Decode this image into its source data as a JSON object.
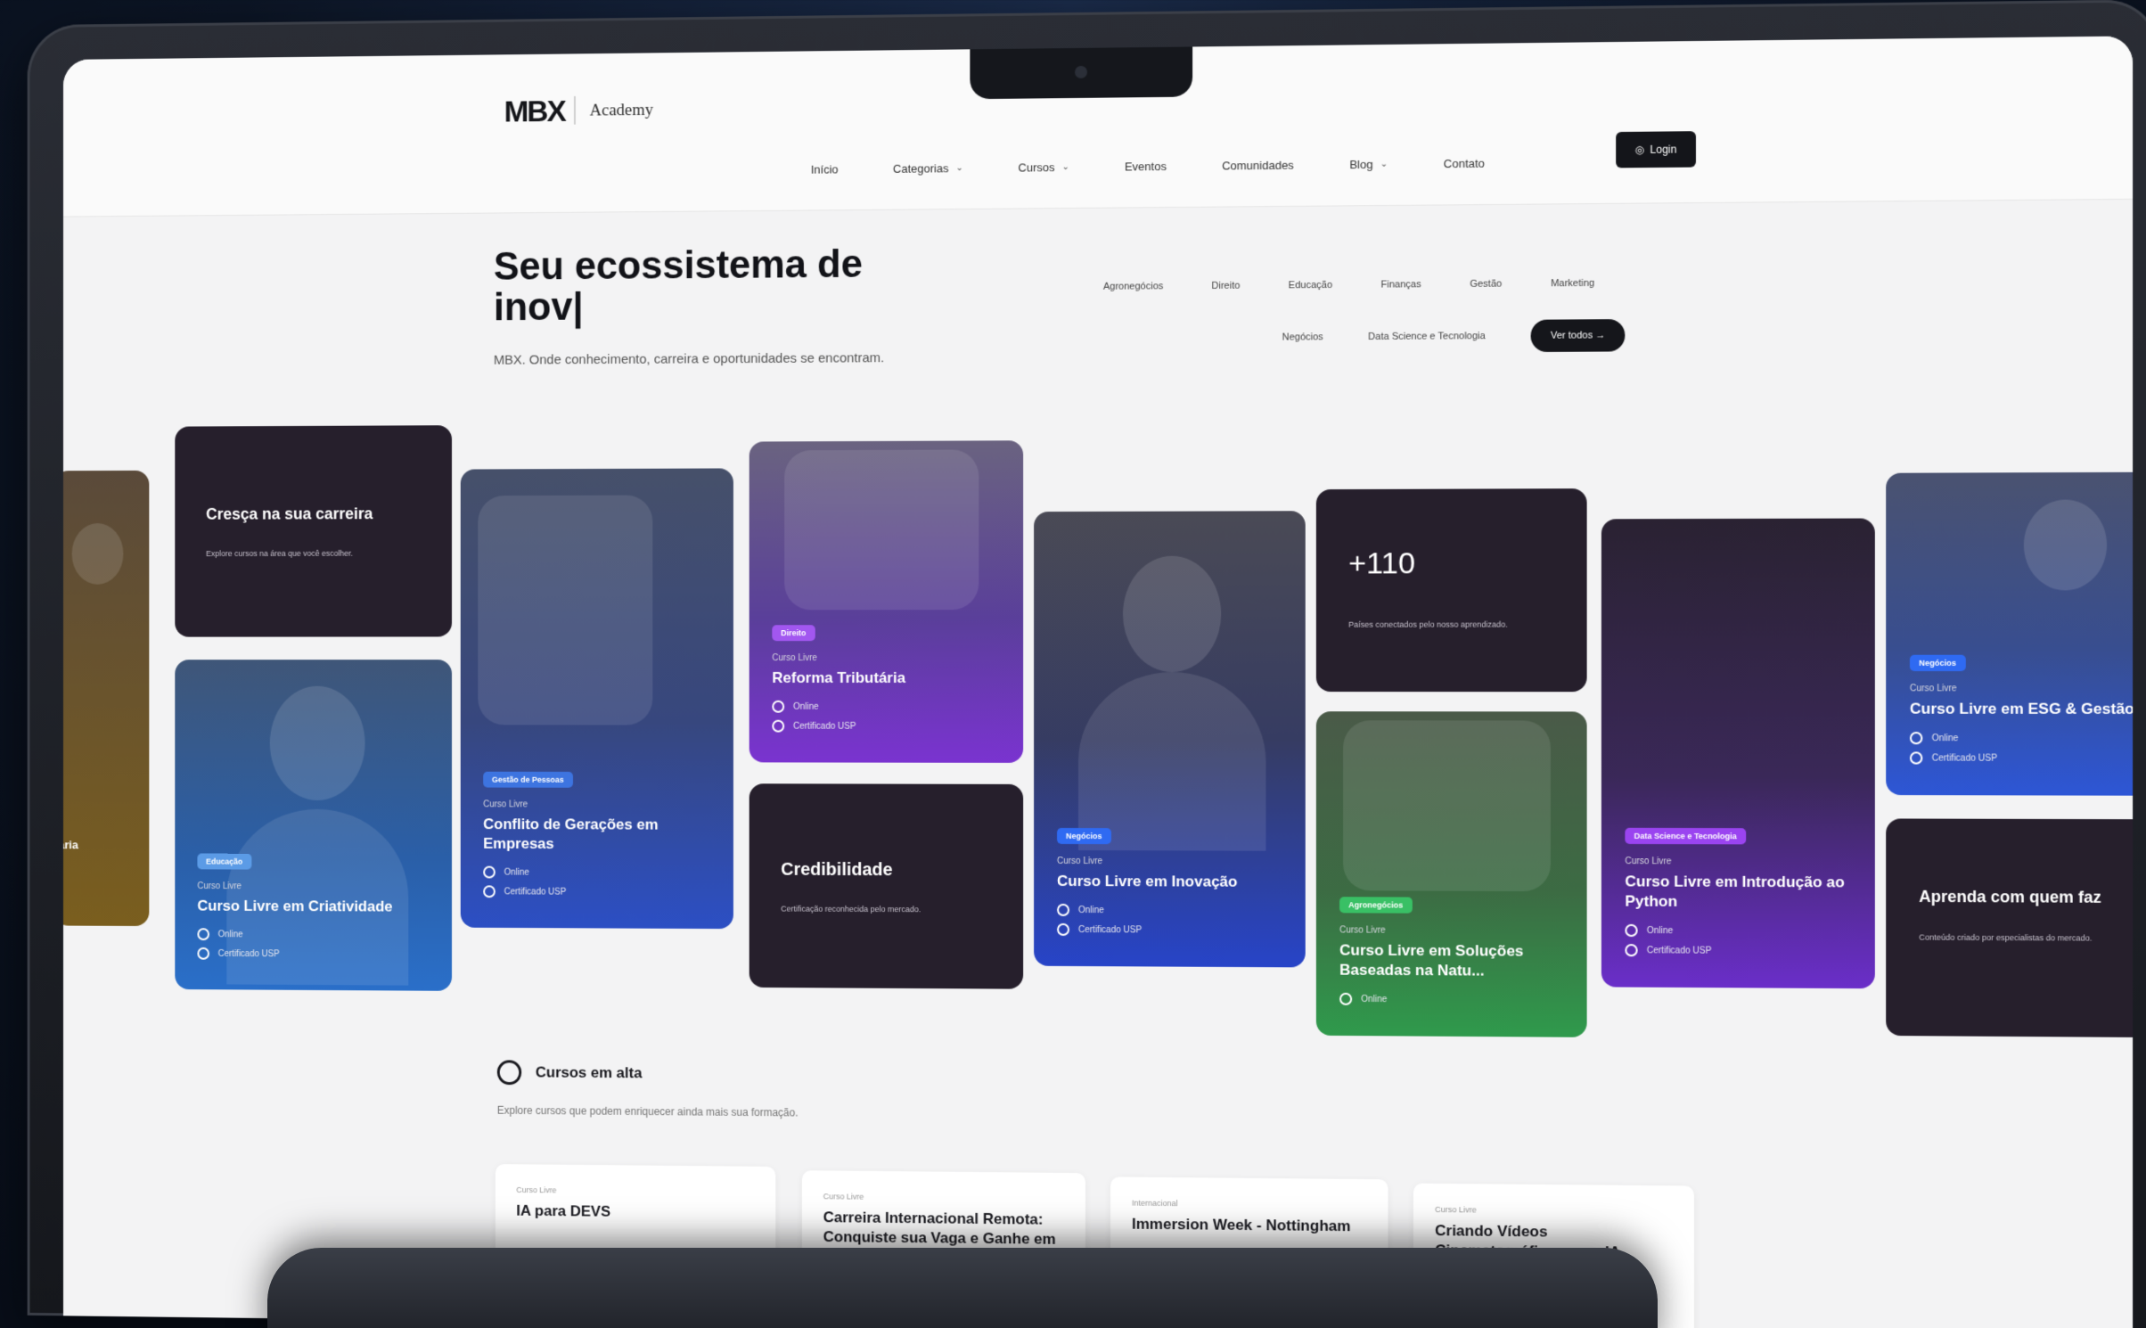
{
  "header": {
    "logo": "MBX",
    "logo_sub": "Academy",
    "nav": [
      "Início",
      "Categorias",
      "Cursos",
      "Eventos",
      "Comunidades",
      "Blog",
      "Contato"
    ],
    "login": "Login"
  },
  "hero": {
    "title": "Seu ecossistema de inov|",
    "subtitle": "MBX. Onde conhecimento, carreira e oportunidades se encontram.",
    "chips_row1": [
      "Agronegócios",
      "Direito",
      "Educação",
      "Finanças",
      "Gestão",
      "Marketing"
    ],
    "chips_row2": [
      "Negócios",
      "Data Science e Tecnologia"
    ],
    "see_all": "Ver todos →"
  },
  "cards": {
    "partial": "tária",
    "career_title": "Cresça na sua carreira",
    "career_sub": "Explore cursos na área que você escolher.",
    "cred_title": "Credibilidade",
    "cred_sub": "Certificação reconhecida pelo mercado.",
    "stat_title": "+110",
    "stat_sub": "Países conectados pelo nosso aprendizado.",
    "learn_title": "Aprenda com quem faz",
    "learn_sub": "Conteúdo criado por especialistas do mercado.",
    "course_type": "Curso Livre",
    "online": "Online",
    "cert": "Certificado USP",
    "courses": [
      {
        "badge": "Educação",
        "title": "Curso Livre em Criatividade",
        "color": "#2b6ec9"
      },
      {
        "badge": "Gestão de Pessoas",
        "title": "Conflito de Gerações em Empresas",
        "color": "#2c63d8"
      },
      {
        "badge": "Direito",
        "title": "Reforma Tributária",
        "color": "#8e3ddb"
      },
      {
        "badge": "Negócios",
        "title": "Curso Livre em Inovação",
        "color": "#2c5bf0"
      },
      {
        "badge": "Agronegócios",
        "title": "Curso Livre em Soluções Baseadas na Natu...",
        "color": "#30b35a"
      },
      {
        "badge": "Data Science e Tecnologia",
        "title": "Curso Livre em Introdução ao Python",
        "color": "#9a3df0"
      },
      {
        "badge": "Negócios",
        "title": "Curso Livre em ESG & Gestão",
        "color": "#2c5bf0"
      }
    ]
  },
  "trending": {
    "title": "Cursos em alta",
    "subtitle": "Explore cursos que podem enriquecer ainda mais sua formação.",
    "items": [
      {
        "type": "Curso Livre",
        "name": "IA para DEVS"
      },
      {
        "type": "Curso Livre",
        "name": "Carreira Internacional Remota: Conquiste sua Vaga e Ganhe em Moeda Forte"
      },
      {
        "type": "Internacional",
        "name": "Immersion Week - Nottingham"
      },
      {
        "type": "Curso Livre",
        "name": "Criando Vídeos Cinematográficos com IA"
      }
    ]
  }
}
